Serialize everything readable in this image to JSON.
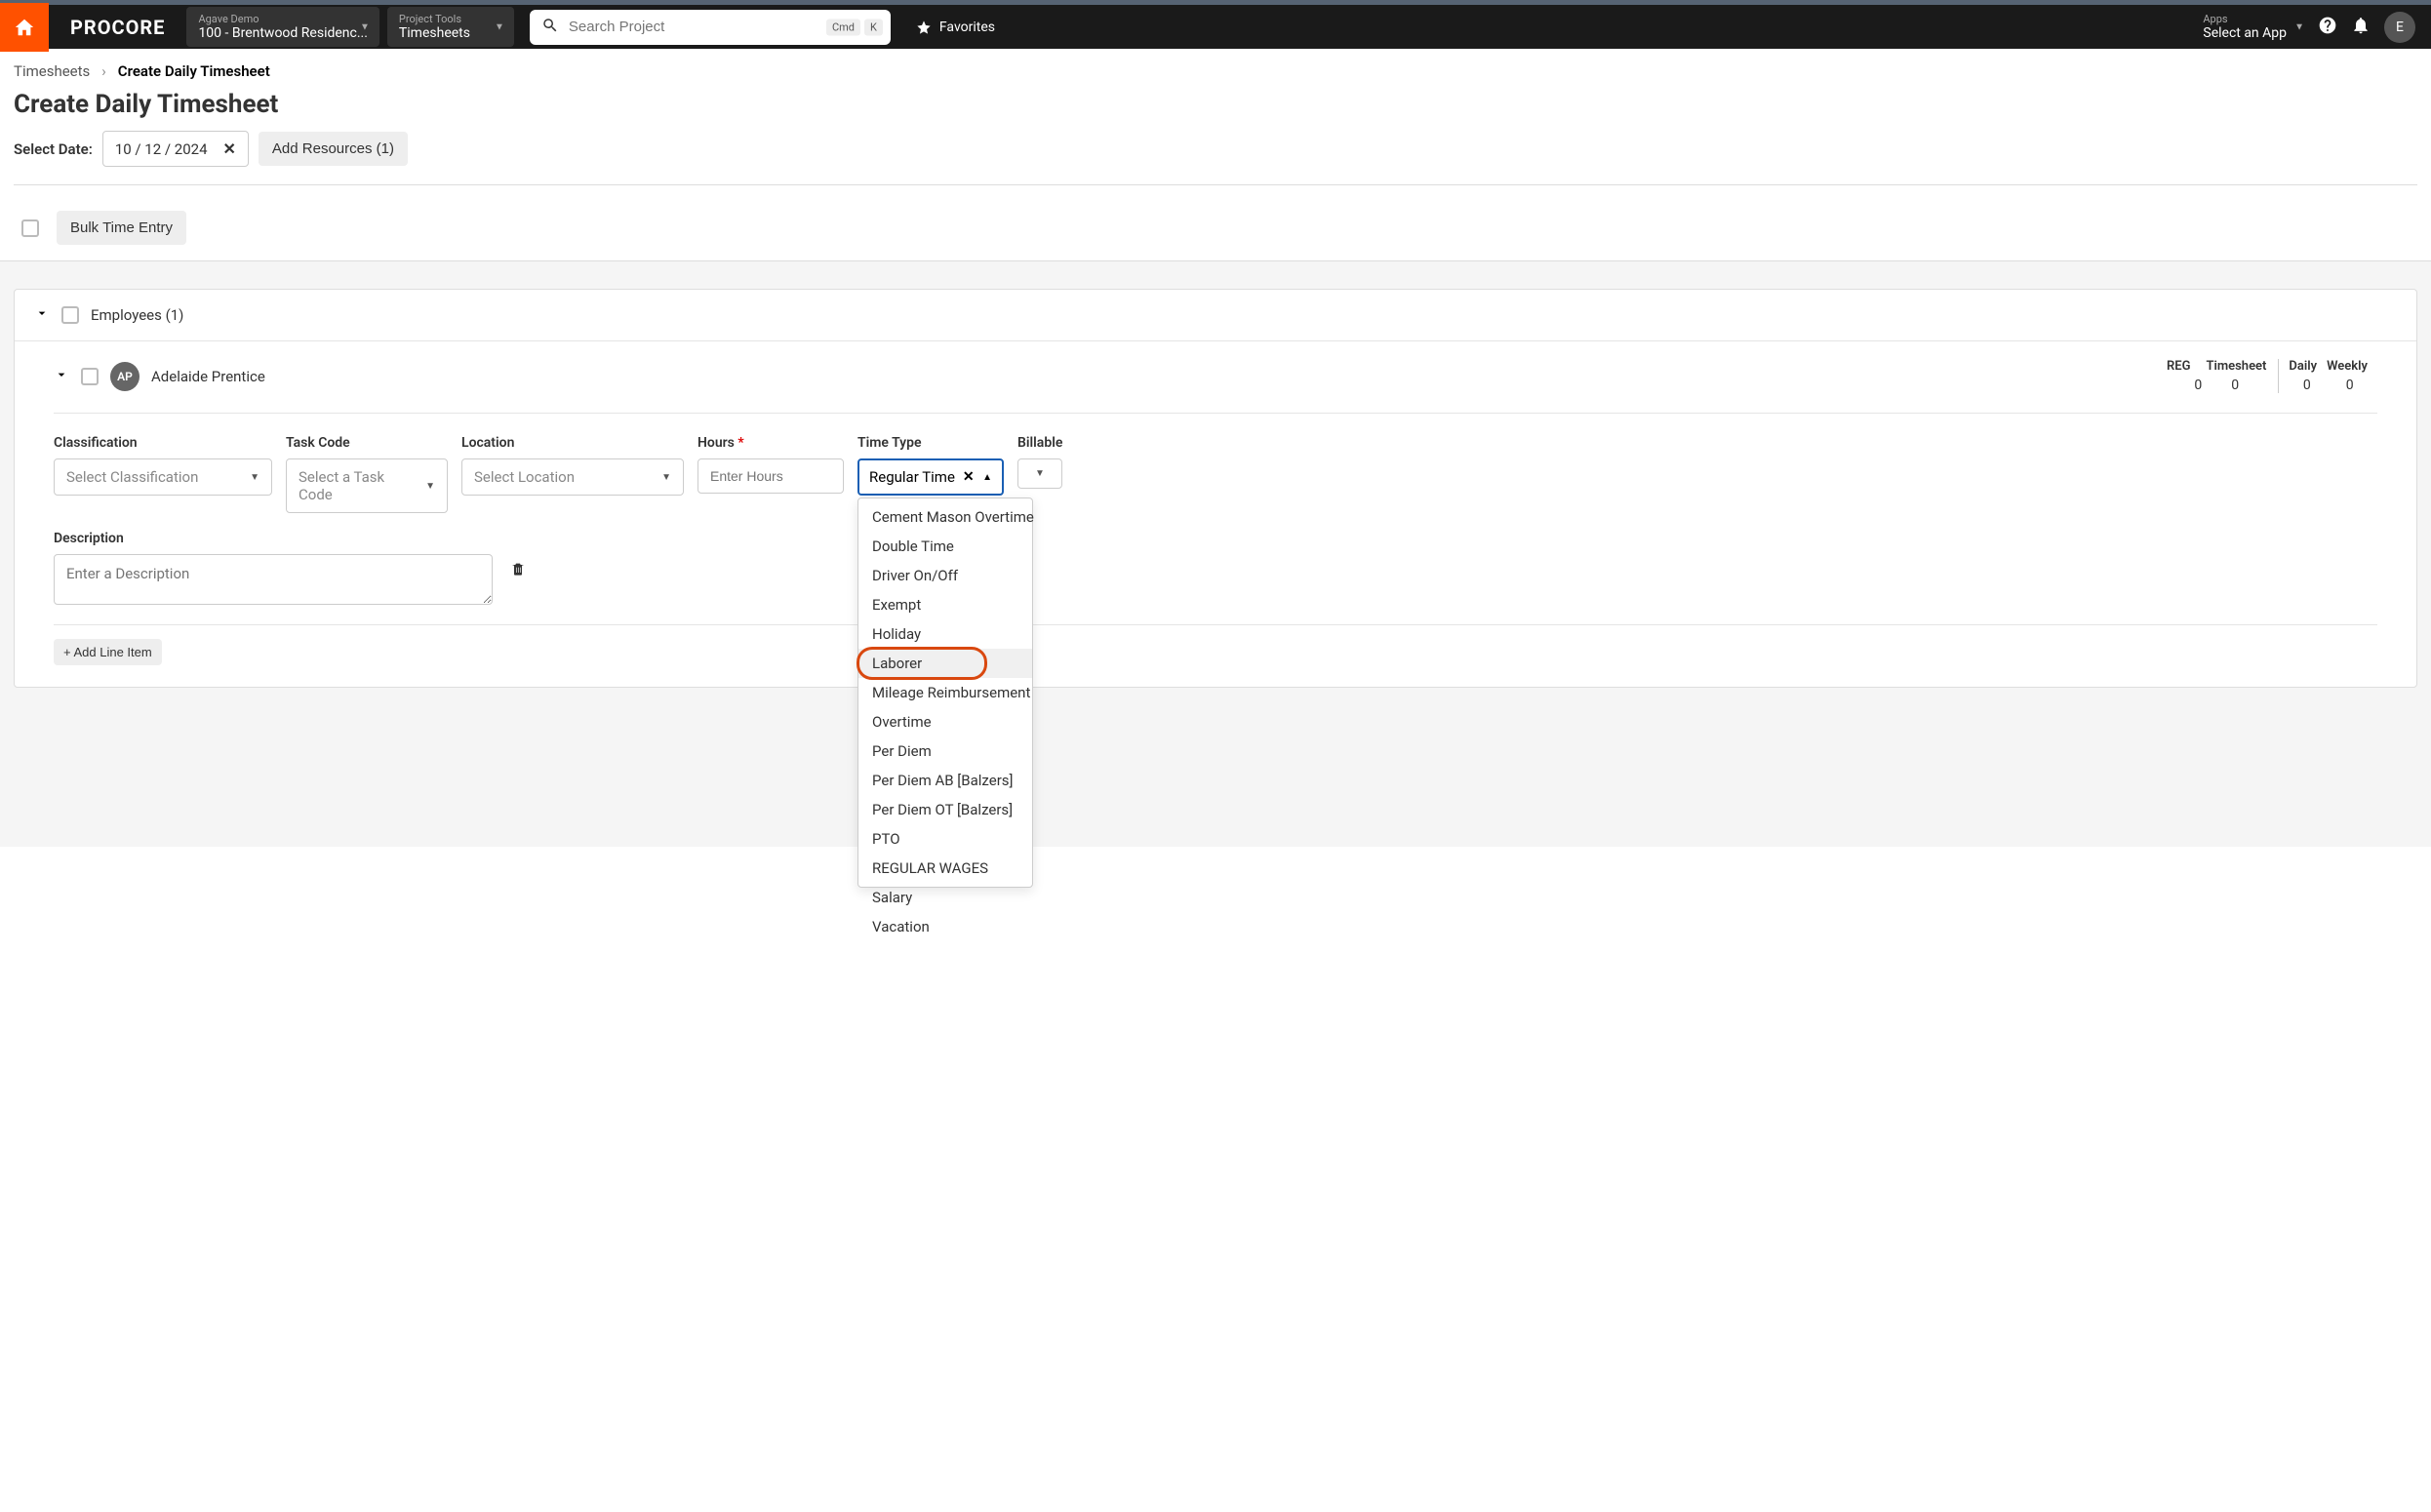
{
  "navbar": {
    "logo": "PROCORE",
    "project": {
      "label": "Agave Demo",
      "value": "100 - Brentwood Residenc..."
    },
    "tools": {
      "label": "Project Tools",
      "value": "Timesheets"
    },
    "search_placeholder": "Search Project",
    "kbd1": "Cmd",
    "kbd2": "K",
    "favorites": "Favorites",
    "apps": {
      "label": "Apps",
      "value": "Select an App"
    },
    "avatar_initial": "E"
  },
  "breadcrumb": {
    "parent": "Timesheets",
    "current": "Create Daily Timesheet"
  },
  "page": {
    "title": "Create Daily Timesheet",
    "date_label": "Select Date:",
    "date_value": "10 / 12 / 2024",
    "add_resources": "Add Resources (1)",
    "bulk_entry": "Bulk Time Entry"
  },
  "section": {
    "label": "Employees (1)"
  },
  "employee": {
    "initials": "AP",
    "name": "Adelaide Prentice",
    "reg_label": "REG",
    "timesheet_label": "Timesheet",
    "reg_value": "0",
    "timesheet_value": "0",
    "daily_label": "Daily",
    "weekly_label": "Weekly",
    "daily_value": "0",
    "weekly_value": "0"
  },
  "fields": {
    "classification": {
      "label": "Classification",
      "placeholder": "Select Classification"
    },
    "task_code": {
      "label": "Task Code",
      "placeholder": "Select a Task Code"
    },
    "location": {
      "label": "Location",
      "placeholder": "Select Location"
    },
    "hours": {
      "label": "Hours",
      "placeholder": "Enter Hours"
    },
    "time_type": {
      "label": "Time Type",
      "value": "Regular Time"
    },
    "billable": {
      "label": "Billable"
    }
  },
  "time_type_options": [
    "Cement Mason Overtime",
    "Double Time",
    "Driver On/Off",
    "Exempt",
    "Holiday",
    "Laborer",
    "Mileage Reimbursement",
    "Overtime",
    "Per Diem",
    "Per Diem AB [Balzers]",
    "Per Diem OT [Balzers]",
    "PTO",
    "REGULAR WAGES",
    "Salary",
    "Vacation"
  ],
  "highlighted_option_index": 5,
  "description": {
    "label": "Description",
    "placeholder": "Enter a Description"
  },
  "add_line": "+ Add Line Item"
}
